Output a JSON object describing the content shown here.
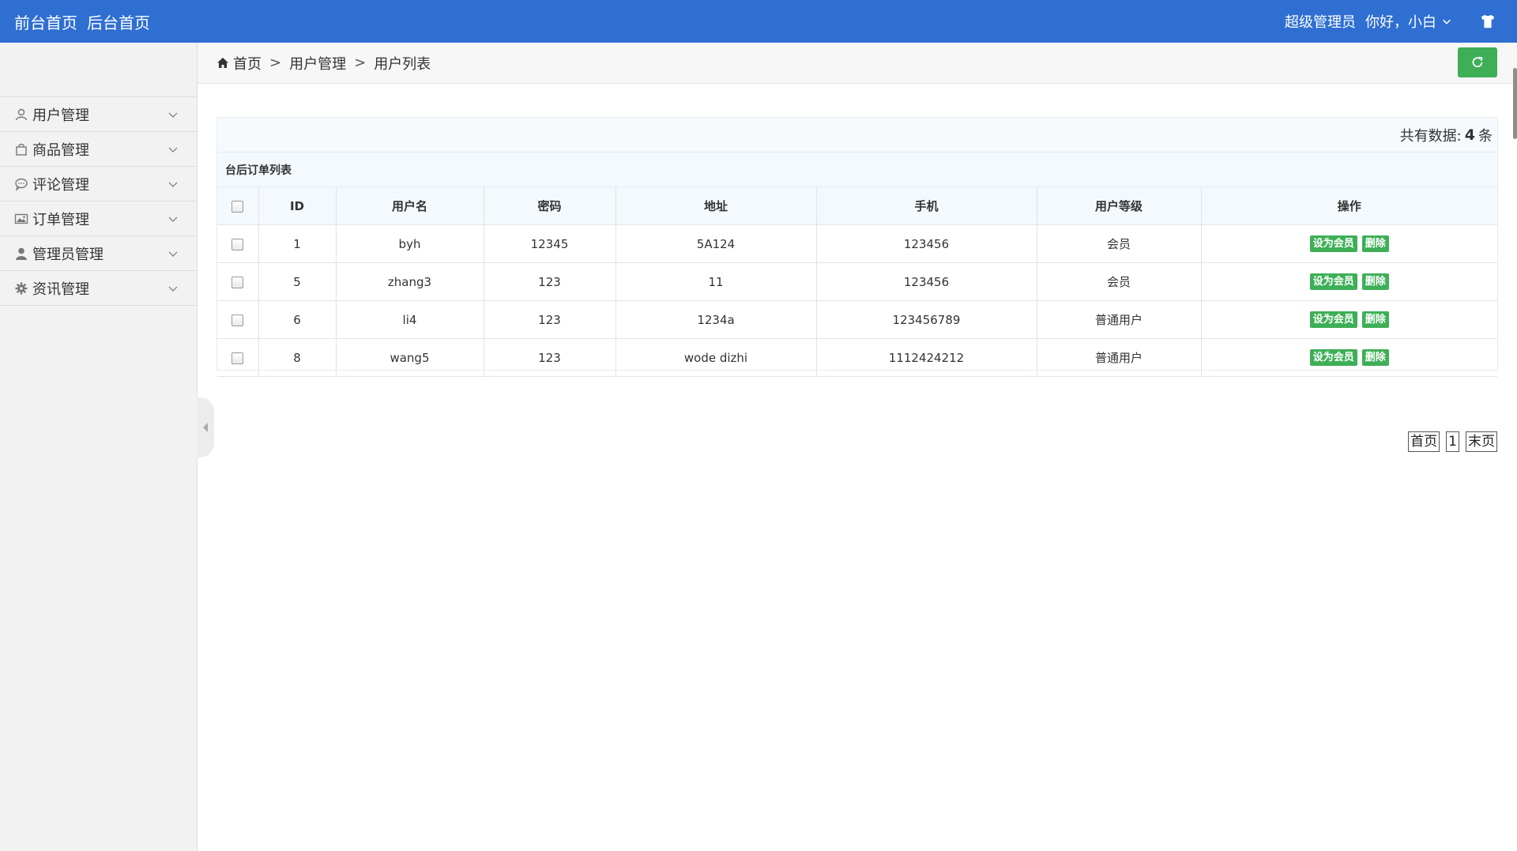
{
  "topbar": {
    "links": [
      "前台首页",
      "后台首页"
    ],
    "role": "超级管理员",
    "greeting": "你好，小白"
  },
  "sidebar": {
    "items": [
      {
        "label": "用户管理",
        "icon": "user-outline-icon"
      },
      {
        "label": "商品管理",
        "icon": "shopping-bag-icon"
      },
      {
        "label": "评论管理",
        "icon": "comment-icon"
      },
      {
        "label": "订单管理",
        "icon": "picture-icon"
      },
      {
        "label": "管理员管理",
        "icon": "user-solid-icon"
      },
      {
        "label": "资讯管理",
        "icon": "gear-icon"
      }
    ]
  },
  "breadcrumb": {
    "home": "首页",
    "sep": ">",
    "section": "用户管理",
    "page": "用户列表"
  },
  "summary": {
    "prefix": "共有数据:",
    "count": "4",
    "suffix": "条"
  },
  "table": {
    "title": "台后订单列表",
    "headers": [
      "ID",
      "用户名",
      "密码",
      "地址",
      "手机",
      "用户等级",
      "操作"
    ],
    "rows": [
      [
        "1",
        "byh",
        "12345",
        "5A124",
        "123456",
        "会员"
      ],
      [
        "5",
        "zhang3",
        "123",
        "11",
        "123456",
        "会员"
      ],
      [
        "6",
        "li4",
        "123",
        "1234a",
        "123456789",
        "普通用户"
      ],
      [
        "8",
        "wang5",
        "123",
        "wode dizhi",
        "1112424212",
        "普通用户"
      ]
    ],
    "actions": {
      "set_member": "设为会员",
      "delete": "删除"
    }
  },
  "pager": {
    "first": "首页",
    "current": "1",
    "last": "末页"
  },
  "colors": {
    "header_blue": "#2f6fd2",
    "button_green": "#3eaf57"
  }
}
